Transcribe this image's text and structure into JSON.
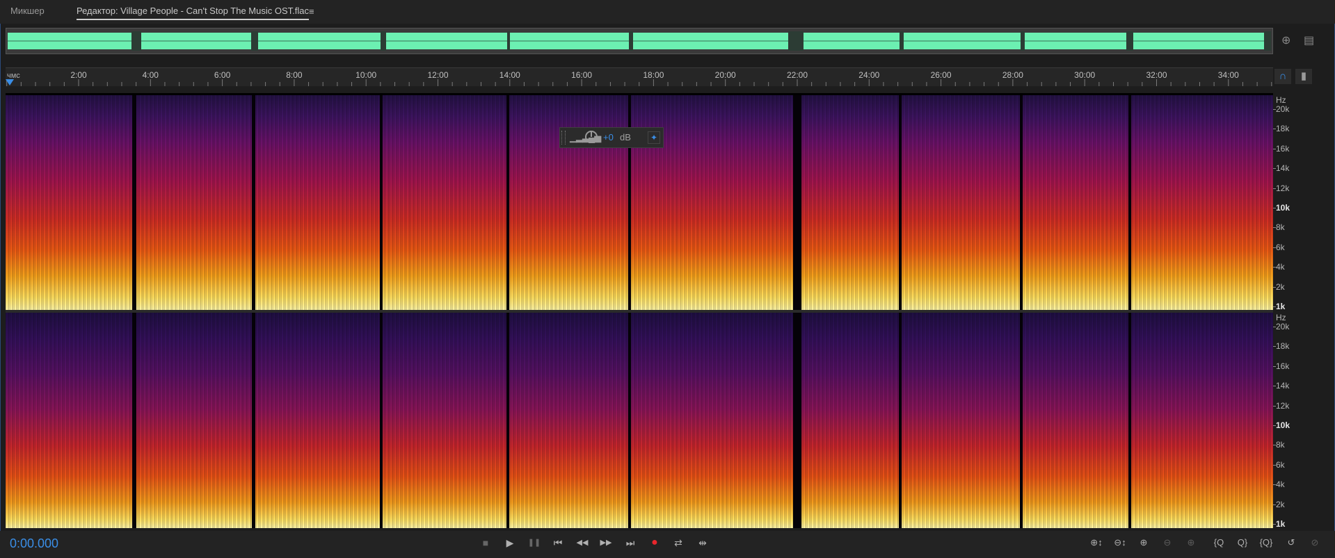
{
  "tabs": {
    "mixer_label": "Микшер",
    "editor_label": "Редактор: Village People - Can't Stop The Music OST.flac",
    "menu_icon": "hamburger-icon",
    "menu_glyph": "≡"
  },
  "overview": {
    "waveform_color": "#6cf0b2",
    "zoom_nav_glyph": "⊕",
    "panel_toggle_glyph": "▤"
  },
  "ruler": {
    "unit_label": "чмс",
    "ticks": [
      "2:00",
      "4:00",
      "6:00",
      "8:00",
      "10:00",
      "12:00",
      "14:00",
      "16:00",
      "18:00",
      "20:00",
      "22:00",
      "24:00",
      "26:00",
      "28:00",
      "30:00",
      "32:00",
      "34:00"
    ],
    "snap_glyph": "∩",
    "marker_glyph": "▮"
  },
  "spectrogram": {
    "freq_unit": "Hz",
    "freq_labels": [
      "20k",
      "18k",
      "16k",
      "14k",
      "12k",
      "10k",
      "8k",
      "6k",
      "4k",
      "2k",
      "1k"
    ],
    "bold_labels": [
      "10k",
      "1k"
    ]
  },
  "hud": {
    "volume_value": "+0",
    "volume_unit": "dB",
    "pin_glyph": "📌"
  },
  "transport": {
    "timecode": "0:00.000",
    "stop_glyph": "■",
    "play_glyph": "▶",
    "pause_glyph": "❚❚",
    "prev_glyph": "⏮",
    "rewind_glyph": "◀◀",
    "forward_glyph": "▶▶",
    "next_glyph": "⏭",
    "record_glyph": "●",
    "loop_glyph": "⇄",
    "skip_glyph": "⇹"
  },
  "zoom": {
    "in_amp": "⊕↕",
    "out_amp": "⊖↕",
    "in_full": "⊕",
    "out_full": "⊖",
    "selection": "⊕",
    "in_left": "{Q",
    "out_right": "Q}",
    "in_both": "{Q}",
    "reset": "↺",
    "last": "⊘"
  }
}
